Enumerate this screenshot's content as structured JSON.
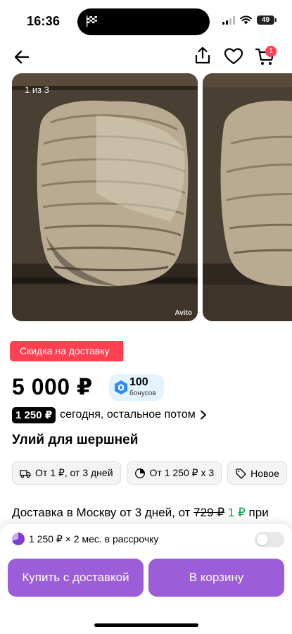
{
  "status_bar": {
    "time": "16:36",
    "battery": "49"
  },
  "nav": {
    "cart_badge": "1",
    "icons": [
      "back-arrow-icon",
      "share-icon",
      "heart-icon",
      "cart-icon"
    ]
  },
  "gallery": {
    "counter": "1 из 3",
    "watermark": "Avito"
  },
  "promo_label": "Скидка на доставку",
  "price": {
    "value": "5 000 ₽",
    "bonus_amount": "100",
    "bonus_word": "бонусов"
  },
  "installment": {
    "pill": "1 250 ₽",
    "text": "сегодня, остальное потом"
  },
  "product_title": "Улий для шершней",
  "chips": [
    {
      "icon": "truck-icon",
      "label": "От 1 ₽, от 3 дней"
    },
    {
      "icon": "installment-clock-icon",
      "label": "От 1 250 ₽ x 3"
    },
    {
      "icon": "tag-icon",
      "label": "Новое"
    }
  ],
  "delivery": {
    "prefix": "Доставка в Москву от 3 дней, от ",
    "old_price": "729 ₽",
    "new_price": "1 ₽",
    "suffix": "при"
  },
  "bottom_sheet": {
    "installment_text": "1 250 ₽ × 2 мес. в рассрочку",
    "installment_toggle_on": false,
    "buy_button": "Купить с доставкой",
    "cart_button": "В корзину"
  },
  "colors": {
    "accent_purple": "#9b5dd8",
    "promo_red": "#ff4053",
    "discount_green": "#02a641",
    "bonus_bg": "#e4f3ff"
  }
}
